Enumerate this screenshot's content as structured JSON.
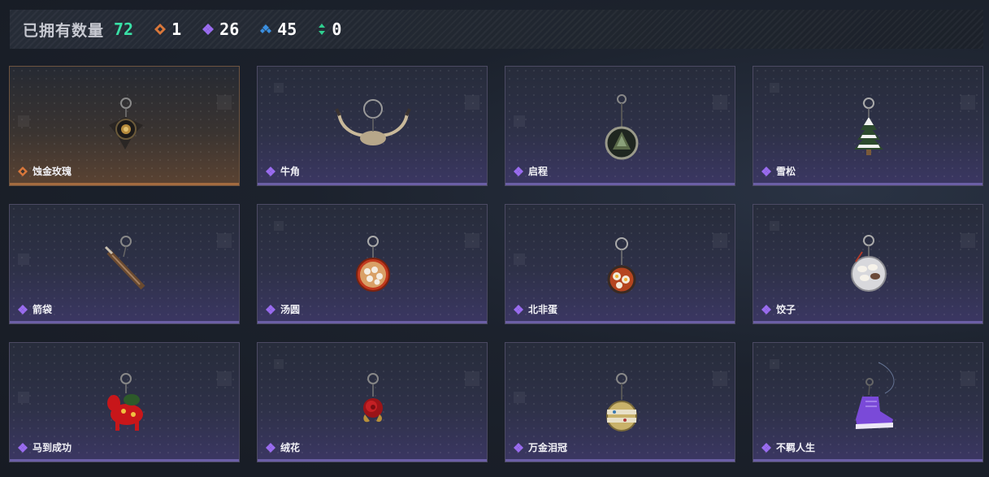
{
  "header": {
    "owned_label": "已拥有数量",
    "owned_count": "72",
    "rarity_counts": [
      {
        "icon": "orange-diamond-icon",
        "color": "#d9773a",
        "count": "1"
      },
      {
        "icon": "purple-diamond-icon",
        "color": "#9a6cf0",
        "count": "26"
      },
      {
        "icon": "blue-diamond-icon",
        "color": "#3a8fe0",
        "count": "45"
      },
      {
        "icon": "green-arrows-icon",
        "color": "#2fcf8f",
        "count": "0"
      }
    ]
  },
  "items": [
    {
      "name": "蚀金玫瑰",
      "rarity": "orange",
      "icon": "gold-rose-keychain-icon"
    },
    {
      "name": "牛角",
      "rarity": "purple",
      "icon": "bull-horns-keychain-icon"
    },
    {
      "name": "启程",
      "rarity": "purple",
      "icon": "medallion-keychain-icon"
    },
    {
      "name": "雪松",
      "rarity": "purple",
      "icon": "snowy-pine-keychain-icon"
    },
    {
      "name": "箭袋",
      "rarity": "purple",
      "icon": "quiver-keychain-icon"
    },
    {
      "name": "汤圆",
      "rarity": "purple",
      "icon": "tangyuan-bowl-keychain-icon"
    },
    {
      "name": "北非蛋",
      "rarity": "purple",
      "icon": "shakshuka-pan-keychain-icon"
    },
    {
      "name": "饺子",
      "rarity": "purple",
      "icon": "dumplings-plate-keychain-icon"
    },
    {
      "name": "马到成功",
      "rarity": "purple",
      "icon": "red-horse-keychain-icon"
    },
    {
      "name": "绒花",
      "rarity": "purple",
      "icon": "velvet-flower-keychain-icon"
    },
    {
      "name": "万金泪冠",
      "rarity": "purple",
      "icon": "jeweled-crown-keychain-icon"
    },
    {
      "name": "不羁人生",
      "rarity": "purple",
      "icon": "purple-sneaker-keychain-icon"
    }
  ]
}
